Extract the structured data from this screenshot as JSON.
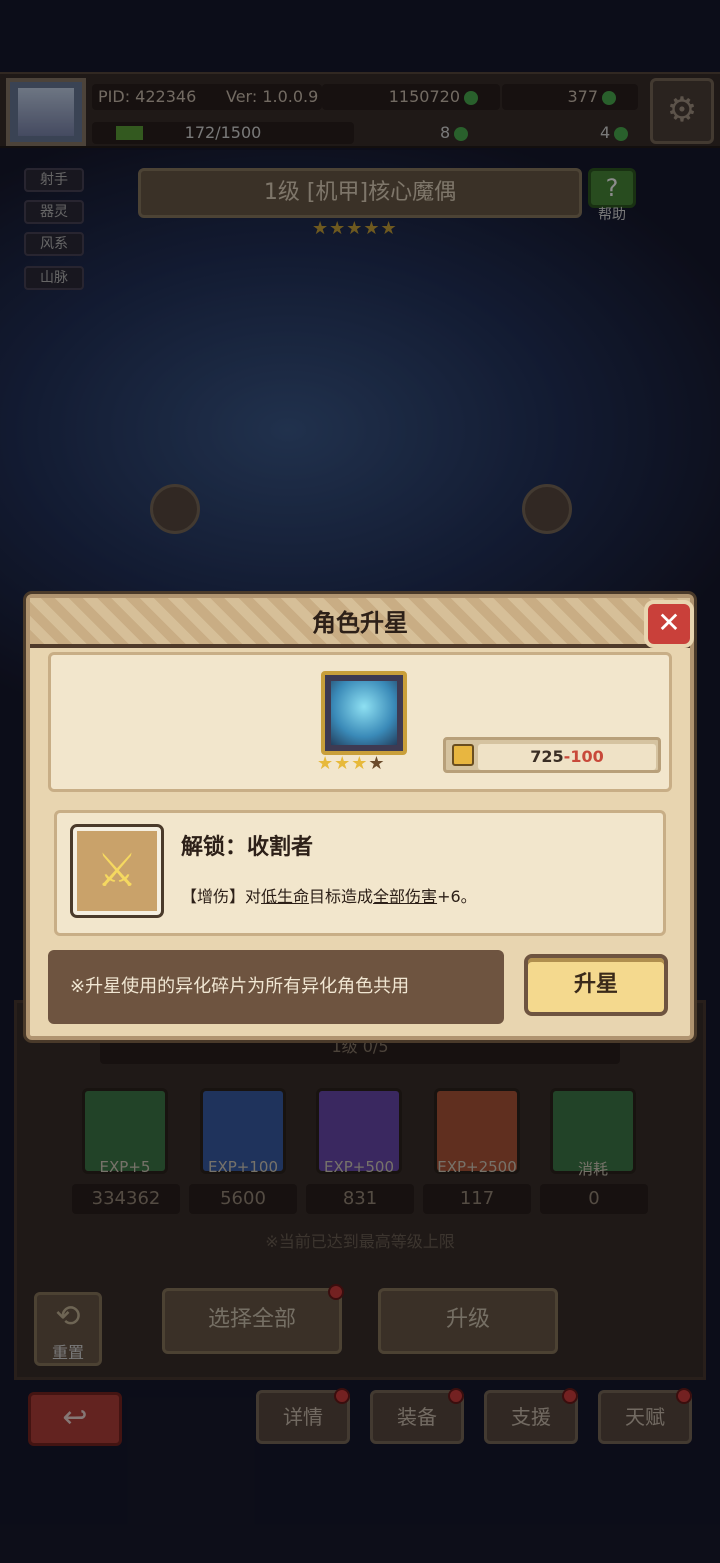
{
  "topbar": {
    "pid": "PID: 422346",
    "version": "Ver: 1.0.0.9",
    "coins": "1150720",
    "gems": "377",
    "exp": "172/1500",
    "exp_fraction": 0.115,
    "clover": "8",
    "key": "4"
  },
  "tags": [
    "射手",
    "器灵",
    "风系",
    "山脉"
  ],
  "character": {
    "title": "1级 [机甲]核心魔偶",
    "stars": "★★★★★",
    "help_label": "帮助"
  },
  "lower": {
    "level_text": "1级 0/5",
    "items": [
      {
        "label": "EXP+5",
        "count": "334362",
        "color": "#3f7a4a"
      },
      {
        "label": "EXP+100",
        "count": "5600",
        "color": "#3a5ea8"
      },
      {
        "label": "EXP+500",
        "count": "831",
        "color": "#6a4ab0"
      },
      {
        "label": "EXP+2500",
        "count": "117",
        "color": "#b0563a"
      },
      {
        "label": "消耗",
        "count": "0",
        "color": "#3f7a4a"
      }
    ],
    "max_note": "※当前已达到最高等级上限",
    "reset_label": "重置",
    "select_all_label": "选择全部",
    "upgrade_label": "升级"
  },
  "tabs": [
    "详情",
    "装备",
    "支援",
    "天赋"
  ],
  "modal": {
    "title": "角色升星",
    "close_symbol": "✕",
    "stars_filled": "★★★",
    "stars_empty": "★",
    "shard_have": "725",
    "shard_cost": "-100",
    "skill_name": "解锁：收割者",
    "skill_desc_prefix": "【增伤】对",
    "skill_desc_u1": "低生命",
    "skill_desc_mid": "目标造成",
    "skill_desc_u2": "全部伤害",
    "skill_desc_suffix": "+6。",
    "note": "※升星使用的异化碎片为所有异化角色共用",
    "upstar_label": "升星",
    "skill_icon": "crossed-swords-icon"
  }
}
